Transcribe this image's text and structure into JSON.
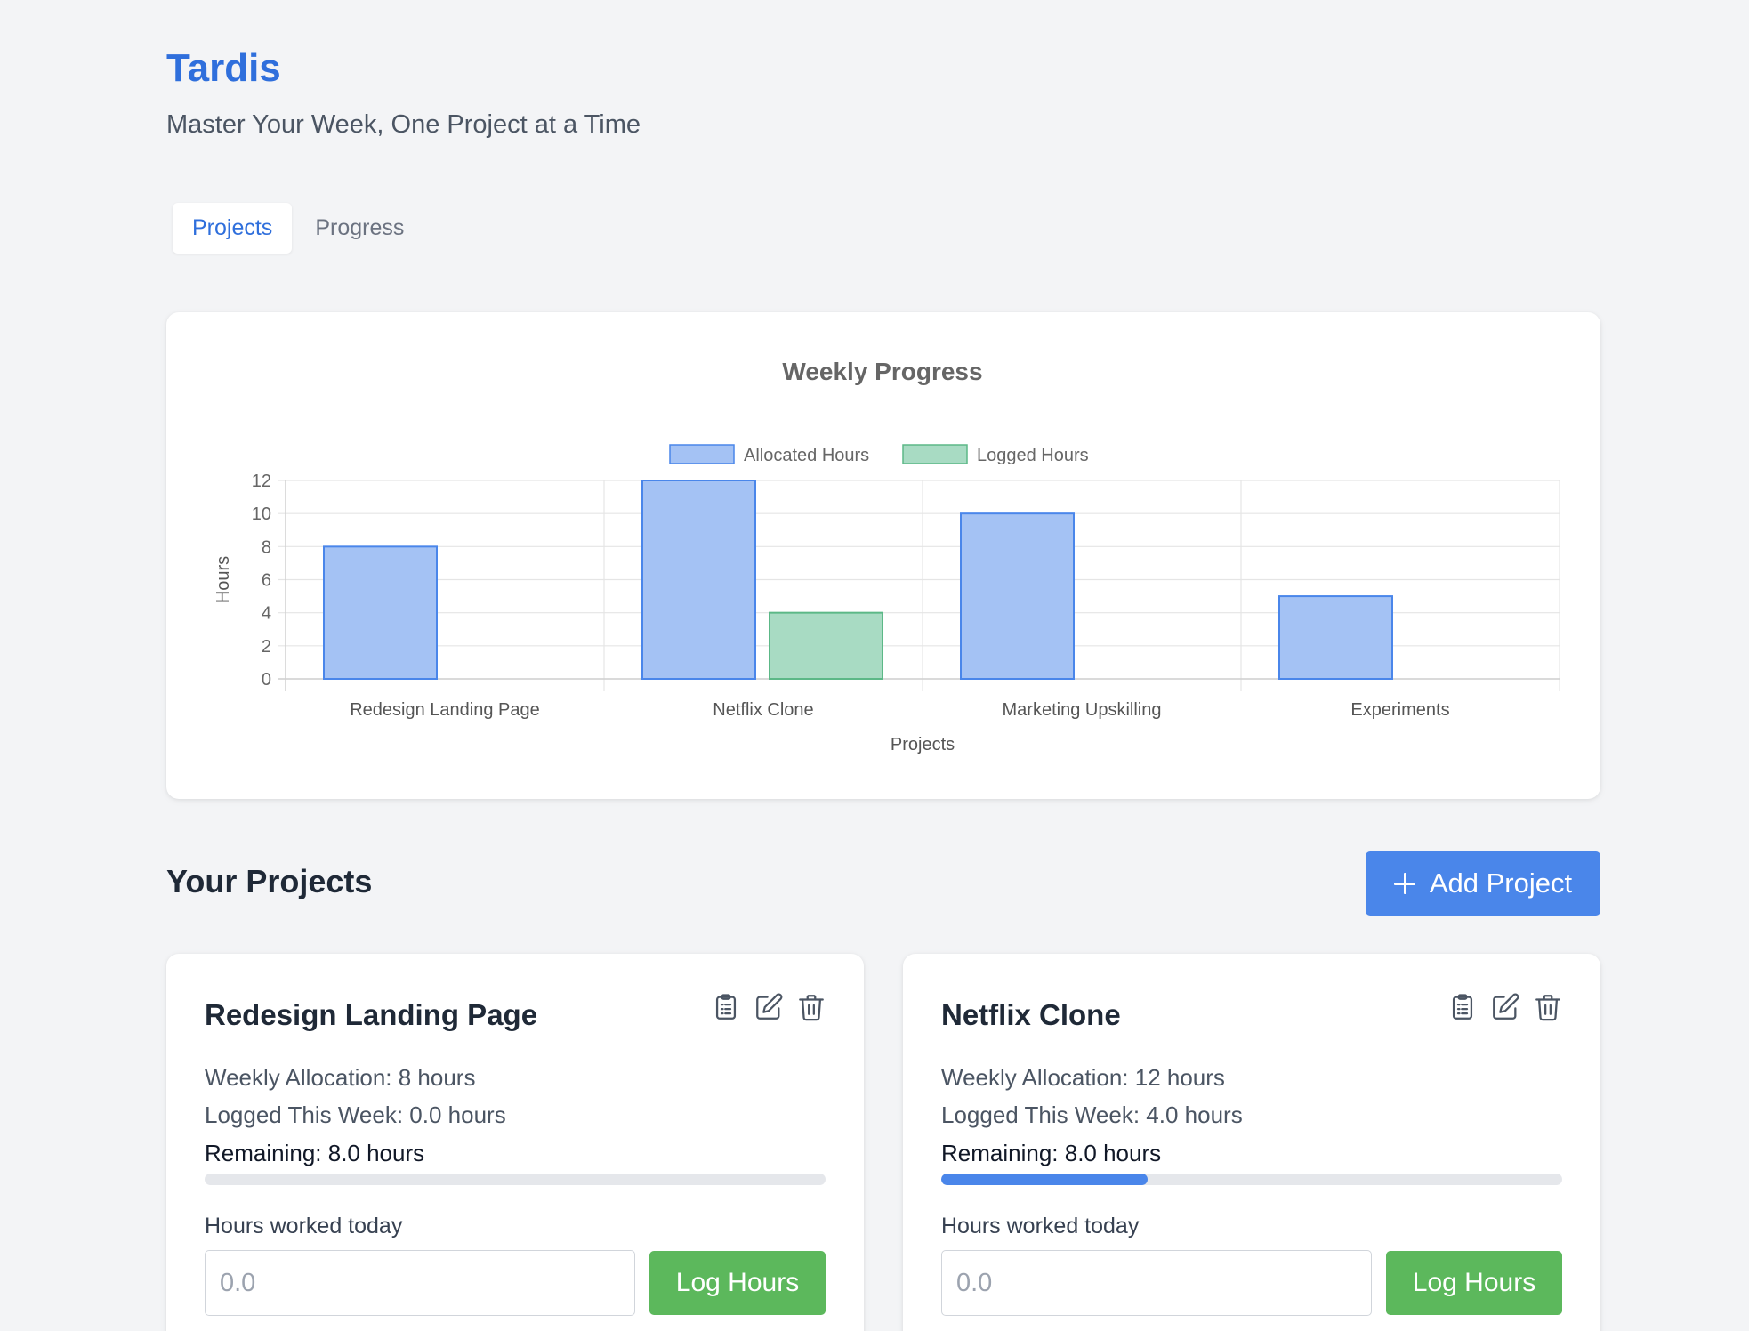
{
  "app": {
    "title": "Tardis",
    "subtitle": "Master Your Week, One Project at a Time"
  },
  "tabs": [
    {
      "label": "Projects",
      "active": true
    },
    {
      "label": "Progress",
      "active": false
    }
  ],
  "chart_data": {
    "type": "bar",
    "title": "Weekly Progress",
    "xlabel": "Projects",
    "ylabel": "Hours",
    "categories": [
      "Redesign Landing Page",
      "Netflix Clone",
      "Marketing Upskilling",
      "Experiments"
    ],
    "series": [
      {
        "name": "Allocated Hours",
        "values": [
          8,
          12,
          10,
          5
        ],
        "color": "#a4c2f4",
        "border": "#4a86ea"
      },
      {
        "name": "Logged Hours",
        "values": [
          0,
          4,
          0,
          0
        ],
        "color": "#a8dbc3",
        "border": "#5cb887"
      }
    ],
    "ylim": [
      0,
      12
    ],
    "yticks": [
      0,
      2,
      4,
      6,
      8,
      10,
      12
    ],
    "grid": true,
    "legend": "top-center"
  },
  "projects_section": {
    "title": "Your Projects",
    "add_button_label": "Add Project"
  },
  "projects": [
    {
      "name": "Redesign Landing Page",
      "allocation": "Weekly Allocation: 8 hours",
      "logged": "Logged This Week: 0.0 hours",
      "remaining": "Remaining: 8.0 hours",
      "progress": 0.0,
      "hours_label": "Hours worked today",
      "input_placeholder": "0.0",
      "log_button_label": "Log Hours"
    },
    {
      "name": "Netflix Clone",
      "allocation": "Weekly Allocation: 12 hours",
      "logged": "Logged This Week: 4.0 hours",
      "remaining": "Remaining: 8.0 hours",
      "progress": 0.333,
      "hours_label": "Hours worked today",
      "input_placeholder": "0.0",
      "log_button_label": "Log Hours"
    }
  ],
  "icons": {
    "card_actions": [
      "clipboard-icon",
      "edit-icon",
      "trash-icon"
    ],
    "add_button": "plus-icon"
  },
  "colors": {
    "brand": "#2f6fdc",
    "primary": "#4a86ea",
    "success": "#5cb85c",
    "background": "#f3f4f6"
  }
}
